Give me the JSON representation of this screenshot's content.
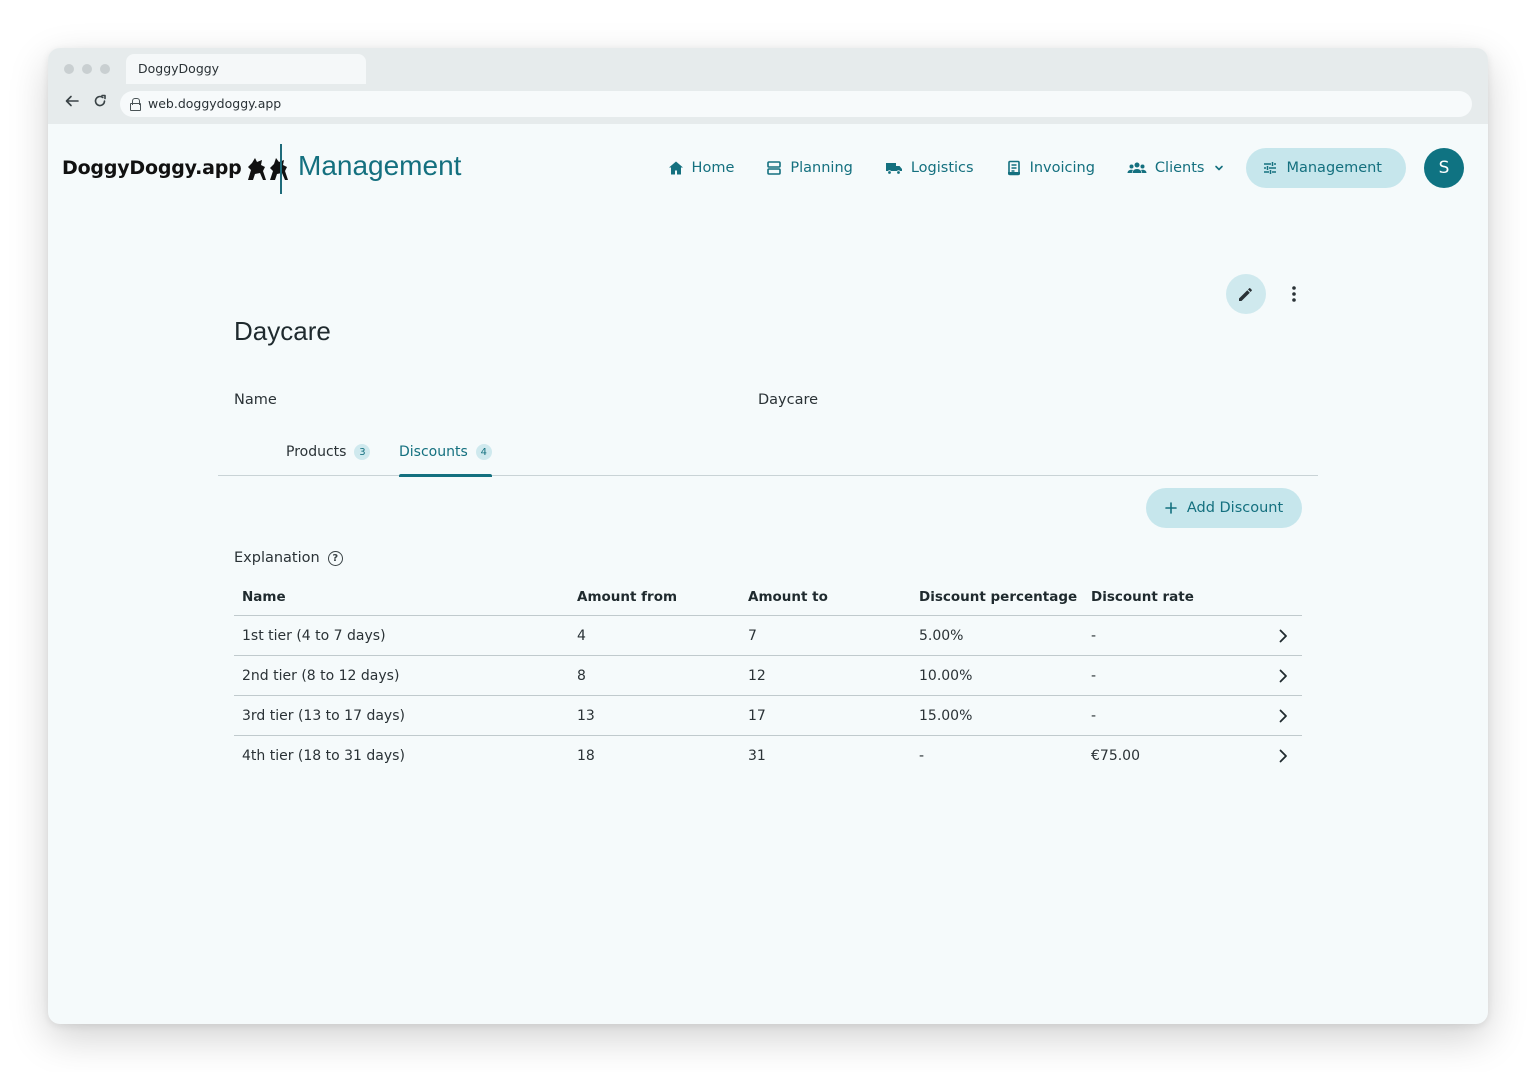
{
  "browser": {
    "tab_title": "DoggyDoggy",
    "url": "web.doggydoggy.app"
  },
  "app": {
    "logo_text": "DoggyDoggy.app",
    "section_title": "Management",
    "accent_color": "#14707f",
    "nav": {
      "home": "Home",
      "planning": "Planning",
      "logistics": "Logistics",
      "invoicing": "Invoicing",
      "clients": "Clients",
      "management": "Management"
    },
    "avatar_initial": "S"
  },
  "page": {
    "title": "Daycare",
    "field_label": "Name",
    "field_value": "Daycare",
    "tabs": [
      {
        "label": "Products",
        "count": "3"
      },
      {
        "label": "Discounts",
        "count": "4"
      }
    ],
    "active_tab": "Discounts",
    "add_button": "Add Discount",
    "explanation": "Explanation"
  },
  "table": {
    "headers": [
      "Name",
      "Amount from",
      "Amount to",
      "Discount percentage",
      "Discount rate"
    ],
    "rows": [
      [
        "1st tier (4 to 7 days)",
        "4",
        "7",
        "5.00%",
        "-"
      ],
      [
        "2nd tier (8 to 12 days)",
        "8",
        "12",
        "10.00%",
        "-"
      ],
      [
        "3rd tier (13 to 17 days)",
        "13",
        "17",
        "15.00%",
        "-"
      ],
      [
        "4th tier (18 to 31 days)",
        "18",
        "31",
        "-",
        "€75.00"
      ]
    ]
  }
}
